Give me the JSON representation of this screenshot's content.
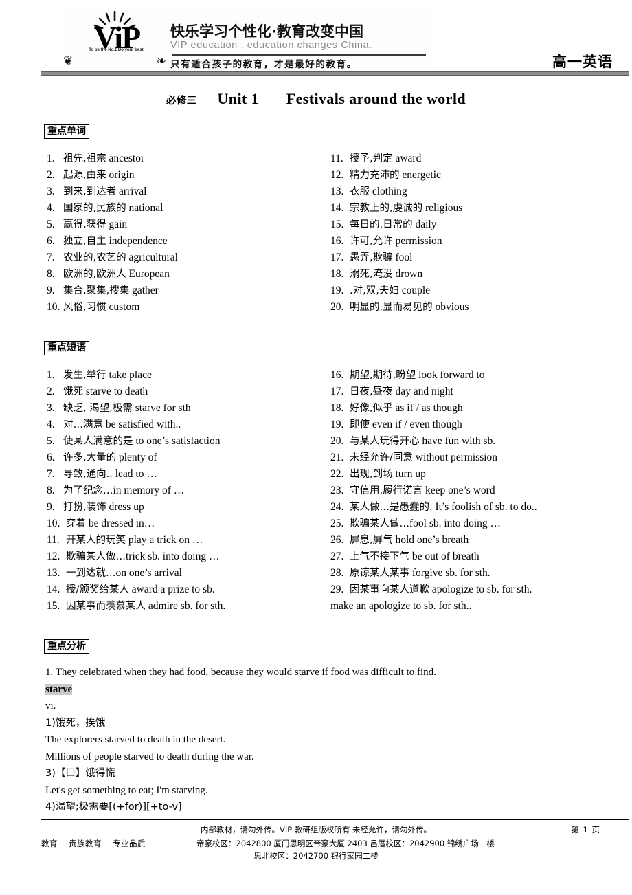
{
  "header": {
    "logo": {
      "wordmark": "ViP",
      "motto": "To be the No.1   Do your best!",
      "slogan_cn": "快乐学习个性化·教育改变中国",
      "slogan_en": "VIP education , education  changes China.",
      "slogan_cn2": "只有适合孩子的教育，才是最好的教育。"
    },
    "subject": "高一英语"
  },
  "title": {
    "book": "必修三",
    "unit": "Unit 1",
    "topic": "Festivals around the world"
  },
  "sections": {
    "words": {
      "heading": "重点单词",
      "left": [
        {
          "num": "1.",
          "cn": "祖先,祖宗",
          "en": "ancestor"
        },
        {
          "num": "2.",
          "cn": "起源,由来",
          "en": "origin"
        },
        {
          "num": "3.",
          "cn": "到来,到达者",
          "en": "arrival"
        },
        {
          "num": "4.",
          "cn": "国家的,民族的",
          "en": "national"
        },
        {
          "num": "5.",
          "cn": "赢得,获得",
          "en": "gain"
        },
        {
          "num": "6.",
          "cn": "独立,自主",
          "en": "independence"
        },
        {
          "num": "7.",
          "cn": "农业的,农艺的",
          "en": "agricultural"
        },
        {
          "num": "8.",
          "cn": "欧洲的,欧洲人",
          "en": "European"
        },
        {
          "num": "9.",
          "cn": "集合,聚集,搜集",
          "en": "gather"
        },
        {
          "num": "10.",
          "cn": "风俗,习惯",
          "en": "custom"
        }
      ],
      "right": [
        {
          "num": "11.",
          "cn": "授予,判定",
          "en": "award"
        },
        {
          "num": "12.",
          "cn": "精力充沛的",
          "en": "energetic"
        },
        {
          "num": "13.",
          "cn": "衣服",
          "en": "clothing"
        },
        {
          "num": "14.",
          "cn": "宗教上的,虔诚的",
          "en": "religious"
        },
        {
          "num": "15.",
          "cn": "每日的,日常的",
          "en": "daily"
        },
        {
          "num": "16.",
          "cn": "许可,允许",
          "en": "permission"
        },
        {
          "num": "17.",
          "cn": "愚弄,欺骗",
          "en": "fool"
        },
        {
          "num": "18.",
          "cn": "溺死,淹没",
          "en": "drown"
        },
        {
          "num": "19.",
          "cn": ".对,双,夫妇",
          "en": "couple"
        },
        {
          "num": "20.",
          "cn": "明显的,显而易见的",
          "en": "obvious"
        }
      ]
    },
    "phrases": {
      "heading": "重点短语",
      "left": [
        {
          "num": "1.",
          "cn": "发生,举行",
          "en": "take place"
        },
        {
          "num": "2.",
          "cn": "饿死",
          "en": "starve to death"
        },
        {
          "num": "3.",
          "cn": "缺乏, 渴望,极需",
          "en": "starve for sth"
        },
        {
          "num": "4.",
          "cn": "对…满意",
          "en": "be satisfied with.."
        },
        {
          "num": "5.",
          "cn": "使某人满意的是",
          "en": "to one’s satisfaction"
        },
        {
          "num": "6.",
          "cn": "许多,大量的",
          "en": "plenty of"
        },
        {
          "num": "7.",
          "cn": "导致,通向..",
          "en": "lead to …"
        },
        {
          "num": "8.",
          "cn": "为了纪念…",
          "en": "in memory of …"
        },
        {
          "num": "9.",
          "cn": "打扮,装饰",
          "en": "dress up"
        },
        {
          "num": "10.",
          "cn": "穿着",
          "en": "be dressed in…"
        },
        {
          "num": "11.",
          "cn": "开某人的玩笑",
          "en": "play a trick on …"
        },
        {
          "num": "12.",
          "cn": "欺骗某人做…",
          "en": "trick sb. into doing …"
        },
        {
          "num": "13.",
          "cn": "一到达就…",
          "en": "on one’s arrival"
        },
        {
          "num": "14.",
          "cn": "授/颁奖给某人",
          "en": "award a prize to sb."
        },
        {
          "num": "15.",
          "cn": "因某事而羡慕某人",
          "en": "admire sb. for sth."
        }
      ],
      "right": [
        {
          "num": "16.",
          "cn": "期望,期待,盼望",
          "en": "look forward to"
        },
        {
          "num": "17.",
          "cn": "日夜,昼夜",
          "en": "day and night"
        },
        {
          "num": "18.",
          "cn": "好像,似乎",
          "en": "as if / as though"
        },
        {
          "num": "19.",
          "cn": "即使",
          "en": "even if / even though"
        },
        {
          "num": "20.",
          "cn": "与某人玩得开心",
          "en": "have fun with sb."
        },
        {
          "num": "21.",
          "cn": "未经允许/同意",
          "en": "without permission"
        },
        {
          "num": "22.",
          "cn": "出现,到场",
          "en": "turn up"
        },
        {
          "num": "23.",
          "cn": "守信用,履行诺言",
          "en": "keep one’s word"
        },
        {
          "num": "24.",
          "cn": "某人做…是愚蠢的.",
          "en": "It’s foolish of sb. to do.."
        },
        {
          "num": "25.",
          "cn": "欺骗某人做…",
          "en": "fool sb. into doing …"
        },
        {
          "num": "26.",
          "cn": "屏息,屏气",
          "en": "hold one’s breath"
        },
        {
          "num": "27.",
          "cn": "上气不接下气",
          "en": "be out of breath"
        },
        {
          "num": "28.",
          "cn": "原谅某人某事",
          "en": "forgive sb. for sth."
        },
        {
          "num": "29.",
          "cn": "因某事向某人道歉",
          "en": "apologize to sb. for sth."
        }
      ],
      "right_extra": "make an apologize to sb. for sth.."
    },
    "analysis": {
      "heading": "重点分析",
      "sentence": "1. They celebrated when they had food, because they would starve if food was difficult to find.",
      "headword": "starve",
      "pos": "vi.",
      "entries": [
        "1)饿死，挨饿",
        "The explorers starved to death in the desert.",
        "Millions of people starved to death during the war.",
        "3)【口】饿得慌",
        "Let's get something to eat; I'm starving.",
        "4)渴望;极需要[(+for)][+to-v]"
      ]
    }
  },
  "footer": {
    "notice": "内部教材，请勿外传。VIP 教研组版权所有   未经允许，请勿外传。",
    "page": "第 1 页",
    "left_tags": [
      "教育",
      "贵族教育",
      "专业品质"
    ],
    "campus_line1": "帝豪校区：2042800   厦门思明区帝豪大厦 2403   吕厝校区：2042900   锦绣广场二楼",
    "campus_line2": "思北校区：2042700   银行家园二楼"
  }
}
